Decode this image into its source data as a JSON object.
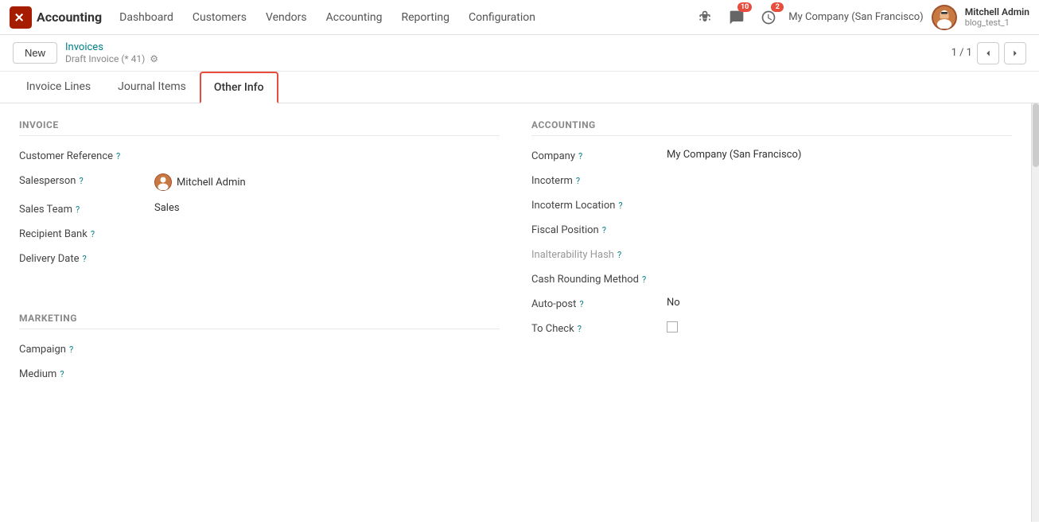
{
  "topnav": {
    "logo_text": "Accounting",
    "links": [
      "Dashboard",
      "Customers",
      "Vendors",
      "Accounting",
      "Reporting",
      "Configuration"
    ],
    "notifications_count": "10",
    "activity_count": "2",
    "company": "My Company (San Francisco)",
    "user_name": "Mitchell Admin",
    "user_sub": "blog_test_1"
  },
  "breadcrumb": {
    "new_label": "New",
    "top_link": "Invoices",
    "bottom_text": "Draft Invoice (* 41)",
    "pagination": "1 / 1"
  },
  "tabs": [
    {
      "label": "Invoice Lines",
      "active": false
    },
    {
      "label": "Journal Items",
      "active": false
    },
    {
      "label": "Other Info",
      "active": true
    }
  ],
  "invoice_section": {
    "title": "INVOICE",
    "fields": [
      {
        "label": "Customer Reference",
        "help": true,
        "value": ""
      },
      {
        "label": "Salesperson",
        "help": true,
        "value": "Mitchell Admin",
        "has_avatar": true
      },
      {
        "label": "Sales Team",
        "help": true,
        "value": "Sales"
      },
      {
        "label": "Recipient Bank",
        "help": true,
        "value": ""
      },
      {
        "label": "Delivery Date",
        "help": true,
        "value": ""
      }
    ]
  },
  "accounting_section": {
    "title": "ACCOUNTING",
    "fields": [
      {
        "label": "Company",
        "help": true,
        "value": "My Company (San Francisco)"
      },
      {
        "label": "Incoterm",
        "help": true,
        "value": ""
      },
      {
        "label": "Incoterm Location",
        "help": true,
        "value": ""
      },
      {
        "label": "Fiscal Position",
        "help": true,
        "value": ""
      },
      {
        "label": "Inalterability Hash",
        "help": true,
        "value": "",
        "muted": true
      },
      {
        "label": "Cash Rounding Method",
        "help": true,
        "value": ""
      },
      {
        "label": "Auto-post",
        "help": true,
        "value": "No"
      },
      {
        "label": "To Check",
        "help": true,
        "value": "checkbox"
      }
    ]
  },
  "marketing_section": {
    "title": "MARKETING",
    "fields": [
      {
        "label": "Campaign",
        "help": true,
        "value": ""
      },
      {
        "label": "Medium",
        "help": true,
        "value": ""
      }
    ]
  }
}
